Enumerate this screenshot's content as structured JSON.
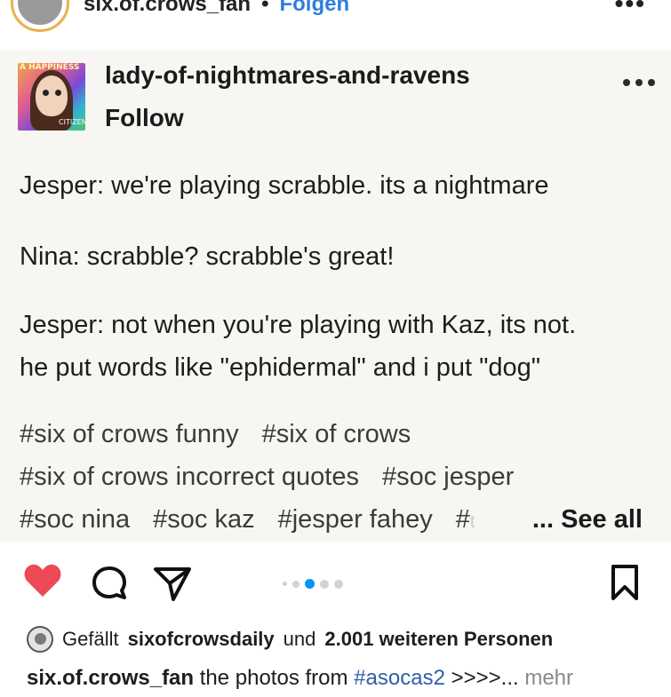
{
  "ig_header": {
    "username": "six.of.crows_fan",
    "separator": "•",
    "follow_label": "Folgen",
    "more_label": "•••"
  },
  "post": {
    "avatar_texts": [
      "A HAPPINESS",
      "CITIZEN"
    ],
    "username": "lady-of-nightmares-and-ravens",
    "follow_label": "Follow",
    "lines": [
      "Jesper: we're playing scrabble. its a nightmare",
      "Nina: scrabble? scrabble's great!",
      "Jesper: not when you're playing with Kaz, its not.",
      "he put words like \"ephidermal\" and i put \"dog\""
    ],
    "tags_row1": [
      "#six of crows funny",
      "#six of crows"
    ],
    "tags_row2": [
      "#six of crows incorrect quotes",
      "#soc jesper"
    ],
    "tags_row3": [
      "#soc nina",
      "#soc kaz",
      "#jesper fahey"
    ],
    "tags_row3_fragment": "#",
    "tags_row3_faded": "t",
    "see_all_label": "... See all"
  },
  "actions": {
    "like_icon": "heart-icon",
    "comment_icon": "comment-icon",
    "share_icon": "send-icon",
    "save_icon": "bookmark-icon",
    "carousel_active_index": 2,
    "carousel_count": 5,
    "like_color": "#ed4956",
    "accent_color": "#0095f6"
  },
  "likes": {
    "prefix": "Gefällt",
    "user": "sixofcrowsdaily",
    "middle": "und",
    "count_text": "2.001 weiteren Personen"
  },
  "caption": {
    "user": "six.of.crows_fan",
    "text_before": "the photos from",
    "hashtag": "#asocas2",
    "text_after": ">>>>...",
    "more_label": "mehr"
  }
}
